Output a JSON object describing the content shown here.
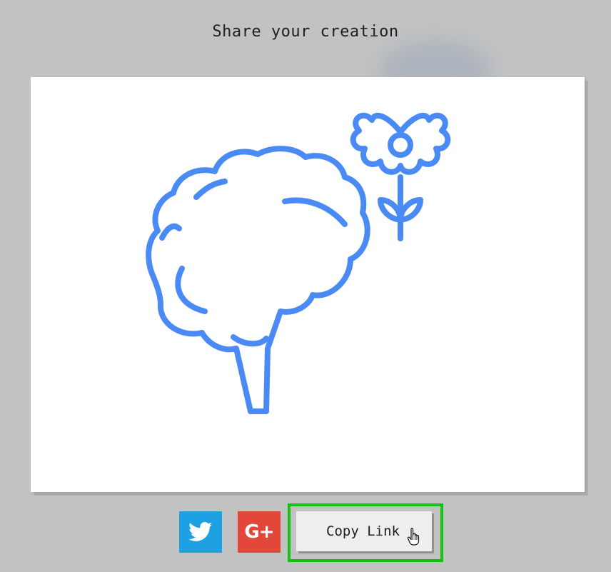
{
  "dialog": {
    "title": "Share your creation"
  },
  "canvas": {
    "stroke_color": "#4a8af4",
    "drawings": [
      "broccoli-tree-drawing",
      "flower-drawing"
    ]
  },
  "share": {
    "twitter_icon": "twitter-bird-icon",
    "twitter_color": "#1da1e2",
    "gplus_label": "G+",
    "gplus_color": "#e2473a",
    "copy_link_label": "Copy Link",
    "highlight_color": "#13c313"
  }
}
